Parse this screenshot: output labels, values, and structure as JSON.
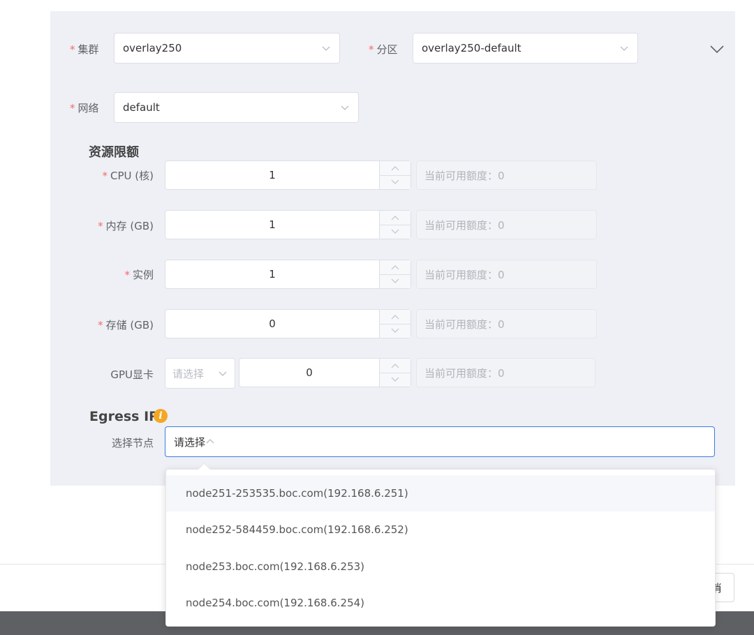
{
  "form": {
    "required_mark": "*",
    "cluster": {
      "label": "集群",
      "value": "overlay250"
    },
    "partition": {
      "label": "分区",
      "value": "overlay250-default"
    },
    "network": {
      "label": "网络",
      "value": "default"
    }
  },
  "resources": {
    "title": "资源限额",
    "rows": [
      {
        "label": "CPU (核)",
        "value": "1",
        "quota": "当前可用额度：0",
        "required": true
      },
      {
        "label": "内存 (GB)",
        "value": "1",
        "quota": "当前可用额度：0",
        "required": true
      },
      {
        "label": "实例",
        "value": "1",
        "quota": "当前可用额度：0",
        "required": true
      },
      {
        "label": "存储 (GB)",
        "value": "0",
        "quota": "当前可用额度：0",
        "required": true
      }
    ],
    "gpu": {
      "label": "GPU显卡",
      "type_placeholder": "请选择",
      "value": "0",
      "quota": "当前可用额度：0"
    }
  },
  "egress": {
    "title": "Egress IP",
    "info_icon": "info-icon",
    "node_label": "选择节点",
    "node_placeholder": "请选择",
    "options": [
      "node251-253535.boc.com(192.168.6.251)",
      "node252-584459.boc.com(192.168.6.252)",
      "node253.boc.com(192.168.6.253)",
      "node254.boc.com(192.168.6.254)"
    ]
  },
  "footer": {
    "cancel_label": "消"
  },
  "colors": {
    "panel": "#eef0f5",
    "required": "#f56c6c",
    "focus_border": "#3a7be0",
    "info": "#f5a623",
    "bottom_bar": "#5f6064"
  }
}
